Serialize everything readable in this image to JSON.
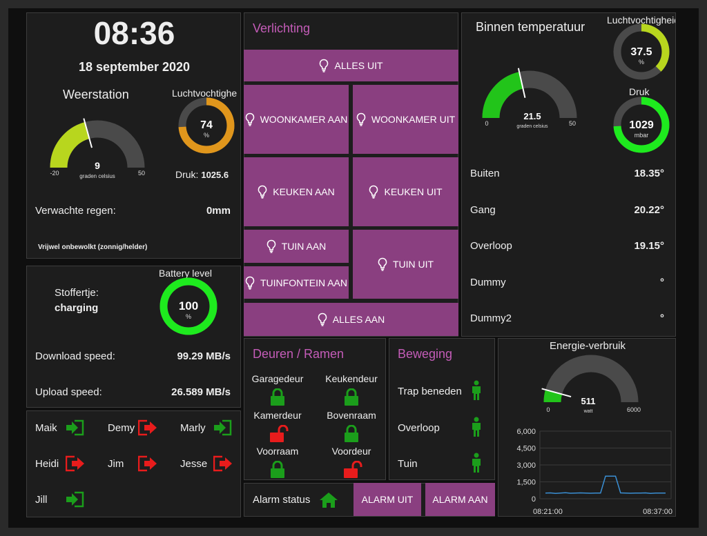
{
  "colors": {
    "accent": "#c45cb8",
    "button": "#8a3f80",
    "gauge_bg": "#4a4a4a",
    "lime": "#b8d61e",
    "orange": "#e0961c",
    "green": "#22c41a",
    "bright_green": "#1eea1e",
    "red": "#e81c1c",
    "lock_green": "#1b9e1b"
  },
  "clock": {
    "time": "08:36",
    "date": "18 september 2020"
  },
  "weather": {
    "title": "Weerstation",
    "temp_gauge": {
      "value": "9",
      "value_num": 9,
      "unit": "graden celsius",
      "min": "-20",
      "max": "50",
      "min_num": -20,
      "max_num": 50
    },
    "humidity_label": "Luchtvochtighe",
    "humidity": {
      "value": "74",
      "value_num": 74,
      "unit": "%",
      "max_num": 100
    },
    "pressure_label": "Druk:",
    "pressure_value": "1025.6",
    "rain_label": "Verwachte regen:",
    "rain_value": "0mm",
    "forecast": "Vrijwel onbewolkt (zonnig/helder)"
  },
  "device": {
    "name": "Stoffertje:",
    "status": "charging",
    "battery_label": "Battery level",
    "battery": {
      "value": "100",
      "value_num": 100,
      "unit": "%",
      "max_num": 100
    },
    "download_label": "Download speed:",
    "download_value": "99.29 MB/s",
    "upload_label": "Upload speed:",
    "upload_value": "26.589 MB/s"
  },
  "presence": [
    {
      "name": "Maik",
      "home": true
    },
    {
      "name": "Demy",
      "home": false
    },
    {
      "name": "Marly",
      "home": true
    },
    {
      "name": "Heidi",
      "home": false
    },
    {
      "name": "Jim",
      "home": false
    },
    {
      "name": "Jesse",
      "home": false
    },
    {
      "name": "Jill",
      "home": true
    }
  ],
  "lighting": {
    "title": "Verlichting",
    "buttons": {
      "all_off": "ALLES UIT",
      "living_on": "WOONKAMER AAN",
      "living_off": "WOONKAMER UIT",
      "kitchen_on": "KEUKEN AAN",
      "kitchen_off": "KEUKEN UIT",
      "garden_on": "TUIN AAN",
      "garden_off": "TUIN UIT",
      "fountain_on": "TUINFONTEIN AAN",
      "all_on": "ALLES AAN"
    }
  },
  "indoor": {
    "title": "Binnen temperatuur",
    "temp_gauge": {
      "value": "21.5",
      "value_num": 21.5,
      "unit": "graden celsius",
      "min": "0",
      "max": "50",
      "min_num": 0,
      "max_num": 50
    },
    "humidity_label": "Luchtvochtigheid",
    "humidity": {
      "value": "37.5",
      "value_num": 37.5,
      "unit": "%",
      "max_num": 100
    },
    "pressure_label": "Druk",
    "pressure": {
      "value": "1029",
      "value_num": 1029,
      "unit": "mbar",
      "fill_fraction": 0.74
    },
    "sensors": [
      {
        "name": "Buiten",
        "value": "18.35°"
      },
      {
        "name": "Gang",
        "value": "20.22°"
      },
      {
        "name": "Overloop",
        "value": "19.15°"
      },
      {
        "name": "Dummy",
        "value": "°"
      },
      {
        "name": "Dummy2",
        "value": "°"
      }
    ]
  },
  "doors": {
    "title": "Deuren / Ramen",
    "items": [
      {
        "name": "Garagedeur",
        "locked": true
      },
      {
        "name": "Keukendeur",
        "locked": true
      },
      {
        "name": "Kamerdeur",
        "locked": false
      },
      {
        "name": "Bovenraam",
        "locked": true
      },
      {
        "name": "Voorraam",
        "locked": true
      },
      {
        "name": "Voordeur",
        "locked": false
      }
    ]
  },
  "motion": {
    "title": "Beweging",
    "items": [
      {
        "name": "Trap beneden"
      },
      {
        "name": "Overloop"
      },
      {
        "name": "Tuin"
      }
    ]
  },
  "alarm": {
    "label": "Alarm status",
    "off_button": "ALARM UIT",
    "on_button": "ALARM AAN"
  },
  "energy": {
    "title": "Energie-verbruik",
    "gauge": {
      "value": "511",
      "value_num": 511,
      "unit": "watt",
      "min": "0",
      "max": "6000",
      "min_num": 0,
      "max_num": 6000
    },
    "chart_data": {
      "type": "line",
      "title": "",
      "xlabel": "",
      "ylabel": "",
      "x": [
        "08:21:00",
        "08:37:00"
      ],
      "ylim": [
        0,
        6000
      ],
      "yticks": [
        "6,000",
        "4,500",
        "3,000",
        "1,500",
        "0"
      ],
      "ytick_values": [
        6000,
        4500,
        3000,
        1500,
        0
      ],
      "grid": true,
      "series": [
        {
          "values": [
            500,
            520,
            480,
            510,
            530,
            490,
            500,
            520,
            510,
            490,
            500,
            510,
            2000,
            2000,
            2000,
            520,
            500,
            490,
            510,
            500,
            520,
            480,
            510,
            500,
            511
          ]
        }
      ]
    }
  }
}
